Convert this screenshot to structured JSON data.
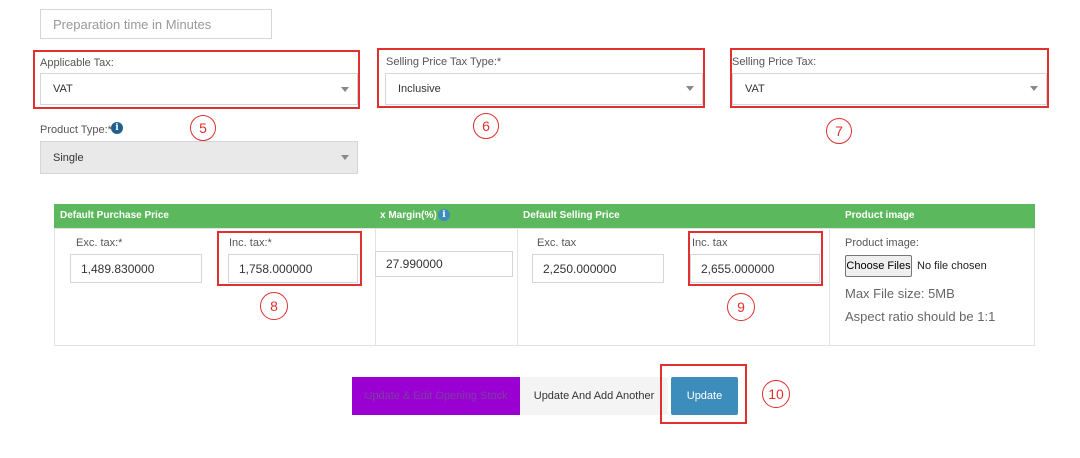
{
  "prep_time": {
    "placeholder": "Preparation time in Minutes"
  },
  "applicable_tax": {
    "label": "Applicable Tax:",
    "value": "VAT"
  },
  "selling_price_tax_type": {
    "label": "Selling Price Tax Type:*",
    "value": "Inclusive"
  },
  "selling_price_tax": {
    "label": "Selling Price Tax:",
    "value": "VAT"
  },
  "product_type": {
    "label": "Product Type:*",
    "value": "Single"
  },
  "info_glyph": "i",
  "table": {
    "headers": {
      "purchase": "Default Purchase Price",
      "margin": "x Margin(%)",
      "selling": "Default Selling Price",
      "image": "Product image"
    },
    "purchase_exc": {
      "label": "Exc. tax:*",
      "value": "1,489.830000"
    },
    "purchase_inc": {
      "label": "Inc. tax:*",
      "value": "1,758.000000"
    },
    "margin_value": "27.990000",
    "selling_exc": {
      "label": "Exc. tax",
      "value": "2,250.000000"
    },
    "selling_inc": {
      "label": "Inc. tax",
      "value": "2,655.000000"
    },
    "image": {
      "label": "Product image:",
      "choose_button": "Choose Files",
      "no_file": "No file chosen",
      "max_size": "Max File size: 5MB",
      "aspect": "Aspect ratio should be 1:1"
    }
  },
  "buttons": {
    "update_edit_stock": "Update & Edit Opening Stock",
    "update_add_another": "Update And Add Another",
    "update": "Update"
  },
  "annotations": [
    "5",
    "6",
    "7",
    "8",
    "9",
    "10"
  ],
  "colors": {
    "table_header": "#5cb85c",
    "purple_button": "#9b00d3",
    "primary_button": "#3c8dbc",
    "annotation_red": "#e0302f"
  }
}
